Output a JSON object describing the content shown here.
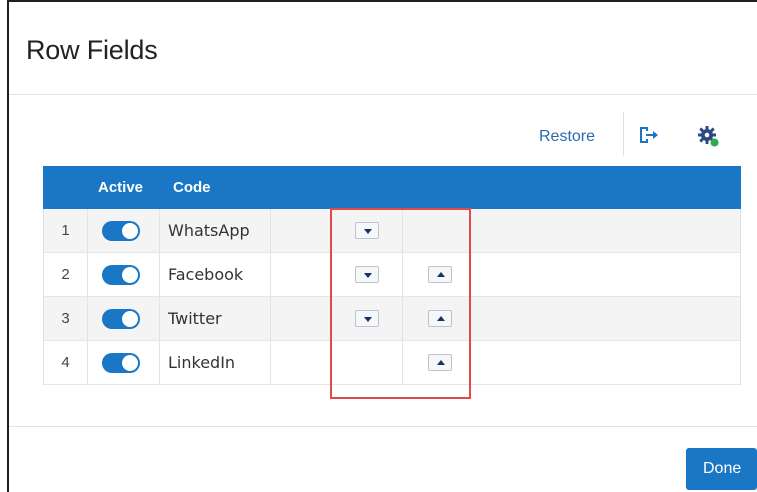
{
  "dialog": {
    "title": "Row Fields"
  },
  "toolbar": {
    "restore_label": "Restore",
    "export_icon": "export-icon",
    "settings_icon": "gear-icon",
    "settings_status_color": "#2fa84f"
  },
  "table": {
    "headers": [
      "",
      "Active",
      "Code"
    ],
    "rows": [
      {
        "index": "1",
        "active": true,
        "code": "WhatsApp",
        "move_down": true,
        "move_up": false
      },
      {
        "index": "2",
        "active": true,
        "code": "Facebook",
        "move_down": true,
        "move_up": true
      },
      {
        "index": "3",
        "active": true,
        "code": "Twitter",
        "move_down": true,
        "move_up": true
      },
      {
        "index": "4",
        "active": true,
        "code": "LinkedIn",
        "move_down": false,
        "move_up": true
      }
    ]
  },
  "footer": {
    "done_label": "Done"
  },
  "colors": {
    "accent": "#1a77c5",
    "link": "#2a6bb0",
    "highlight": "#e24a4a"
  }
}
